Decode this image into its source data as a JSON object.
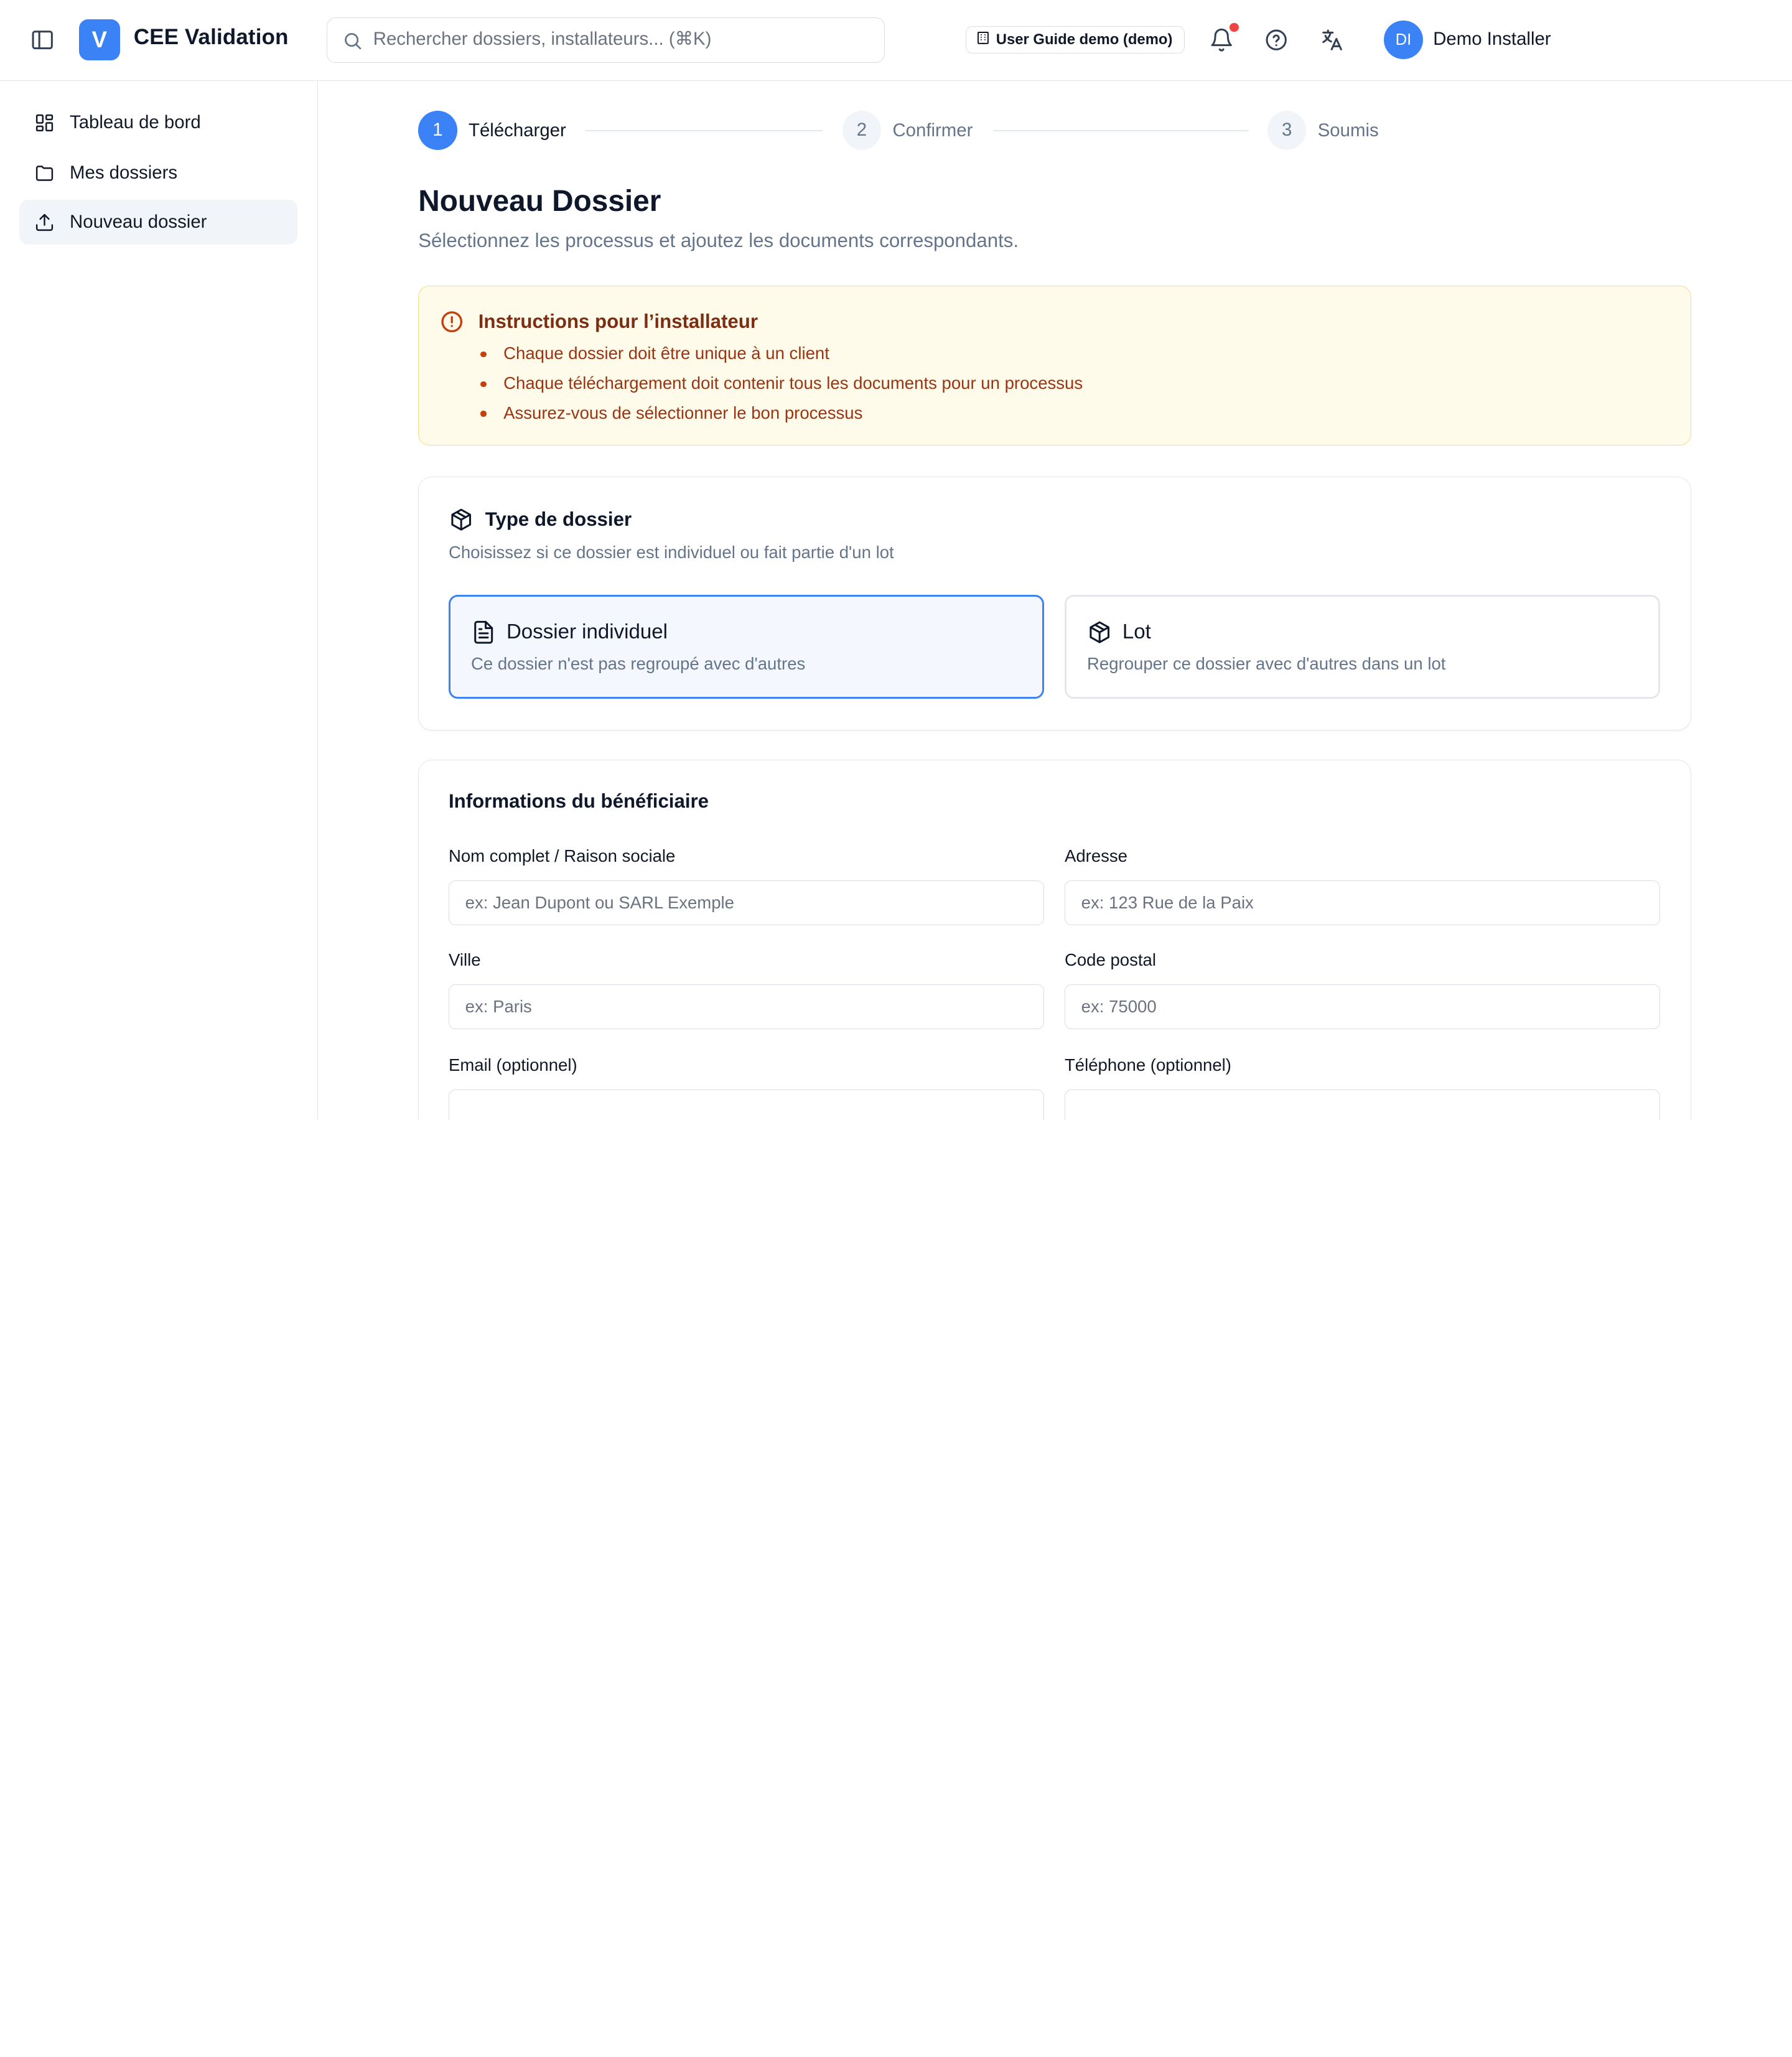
{
  "app": {
    "title": "CEE Validation",
    "logo_letter": "V"
  },
  "header": {
    "search_placeholder": "Rechercher dossiers, installateurs... (⌘K)",
    "demo_badge": "User Guide demo (demo)",
    "user_initials": "DI",
    "user_name": "Demo Installer",
    "icons": [
      "sidebar-toggle-icon",
      "search-icon",
      "bell-icon",
      "help-icon",
      "translate-icon"
    ],
    "notification_dot_color": "#ef4444"
  },
  "sidebar": {
    "items": [
      {
        "label": "Tableau de bord",
        "icon": "dashboard-icon",
        "active": false
      },
      {
        "label": "Mes dossiers",
        "icon": "folder-icon",
        "active": false
      },
      {
        "label": "Nouveau dossier",
        "icon": "upload-icon",
        "active": true
      }
    ]
  },
  "stepper": {
    "steps": [
      {
        "number": "1",
        "label": "Télécharger",
        "active": true
      },
      {
        "number": "2",
        "label": "Confirmer",
        "active": false
      },
      {
        "number": "3",
        "label": "Soumis",
        "active": false
      }
    ]
  },
  "page": {
    "title": "Nouveau Dossier",
    "subtitle": "Sélectionnez les processus et ajoutez les documents correspondants."
  },
  "instructions": {
    "title": "Instructions pour l’installateur",
    "items": [
      "Chaque dossier doit être unique à un client",
      "Chaque téléchargement doit contenir tous les documents pour un processus",
      "Assurez-vous de sélectionner le bon processus"
    ]
  },
  "dossier_type": {
    "title": "Type de dossier",
    "description": "Choisissez si ce dossier est individuel ou fait partie d'un lot",
    "options": [
      {
        "title": "Dossier individuel",
        "description": "Ce dossier n'est pas regroupé avec d'autres",
        "icon": "document-icon",
        "selected": true
      },
      {
        "title": "Lot",
        "description": "Regrouper ce dossier avec d'autres dans un lot",
        "icon": "package-icon",
        "selected": false
      }
    ]
  },
  "beneficiary": {
    "title": "Informations du bénéficiaire",
    "fields": [
      {
        "label": "Nom complet / Raison sociale",
        "placeholder": "ex: Jean Dupont ou SARL Exemple",
        "value": ""
      },
      {
        "label": "Adresse",
        "placeholder": "ex: 123 Rue de la Paix",
        "value": ""
      },
      {
        "label": "Ville",
        "placeholder": "ex: Paris",
        "value": ""
      },
      {
        "label": "Code postal",
        "placeholder": "ex: 75000",
        "value": ""
      },
      {
        "label": "Email (optionnel)",
        "placeholder": "",
        "value": ""
      },
      {
        "label": "Téléphone (optionnel)",
        "placeholder": "",
        "value": ""
      }
    ]
  },
  "colors": {
    "accent": "#3b82f6",
    "warning_bg": "#fefbea",
    "warning_border": "#fcd98a",
    "warning_text": "#9a3412"
  }
}
